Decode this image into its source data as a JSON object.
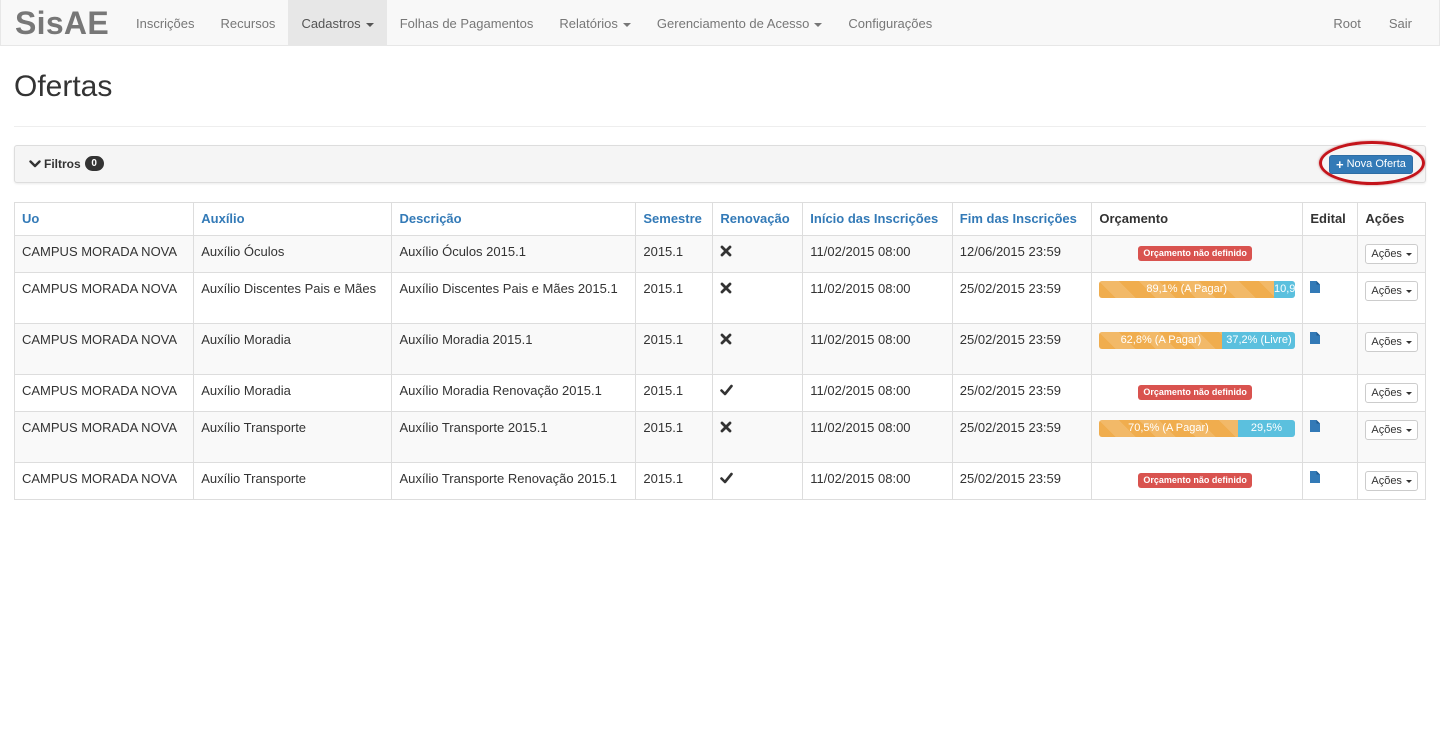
{
  "navbar": {
    "brand": "SisAE",
    "items": [
      {
        "label": "Inscrições",
        "dropdown": false,
        "active": false
      },
      {
        "label": "Recursos",
        "dropdown": false,
        "active": false
      },
      {
        "label": "Cadastros",
        "dropdown": true,
        "active": true
      },
      {
        "label": "Folhas de Pagamentos",
        "dropdown": false,
        "active": false
      },
      {
        "label": "Relatórios",
        "dropdown": true,
        "active": false
      },
      {
        "label": "Gerenciamento de Acesso",
        "dropdown": true,
        "active": false
      },
      {
        "label": "Configurações",
        "dropdown": false,
        "active": false
      }
    ],
    "right": [
      {
        "label": "Root"
      },
      {
        "label": "Sair"
      }
    ]
  },
  "page": {
    "title": "Ofertas"
  },
  "filters": {
    "label": "Filtros",
    "count": "0"
  },
  "new_offer_button": {
    "label": "Nova Oferta"
  },
  "table": {
    "headers": {
      "uo": "Uo",
      "auxilio": "Auxílio",
      "descricao": "Descrição",
      "semestre": "Semestre",
      "renovacao": "Renovação",
      "inicio": "Início das Inscrições",
      "fim": "Fim das Inscrições",
      "orcamento": "Orçamento",
      "edital": "Edital",
      "acoes": "Ações"
    },
    "action_label": "Ações",
    "rows": [
      {
        "uo": "CAMPUS MORADA NOVA",
        "auxilio": "Auxílio Óculos",
        "descricao": "Auxílio Óculos 2015.1",
        "semestre": "2015.1",
        "renovacao": false,
        "inicio": "11/02/2015 08:00",
        "fim": "12/06/2015 23:59",
        "budget": {
          "defined": false,
          "label": "Orçamento não definido"
        },
        "edital": false
      },
      {
        "uo": "CAMPUS MORADA NOVA",
        "auxilio": "Auxílio Discentes Pais e Mães",
        "descricao": "Auxílio Discentes Pais e Mães 2015.1",
        "semestre": "2015.1",
        "renovacao": false,
        "inicio": "11/02/2015 08:00",
        "fim": "25/02/2015 23:59",
        "budget": {
          "defined": true,
          "pagar_pct": 89.1,
          "pagar_label": "89,1% (A Pagar)",
          "livre_pct": 10.9,
          "livre_label": "10,9"
        },
        "edital": true
      },
      {
        "uo": "CAMPUS MORADA NOVA",
        "auxilio": "Auxílio Moradia",
        "descricao": "Auxílio Moradia 2015.1",
        "semestre": "2015.1",
        "renovacao": false,
        "inicio": "11/02/2015 08:00",
        "fim": "25/02/2015 23:59",
        "budget": {
          "defined": true,
          "pagar_pct": 62.8,
          "pagar_label": "62,8% (A Pagar)",
          "livre_pct": 37.2,
          "livre_label": "37,2% (Livre)"
        },
        "edital": true
      },
      {
        "uo": "CAMPUS MORADA NOVA",
        "auxilio": "Auxílio Moradia",
        "descricao": "Auxílio Moradia Renovação 2015.1",
        "semestre": "2015.1",
        "renovacao": true,
        "inicio": "11/02/2015 08:00",
        "fim": "25/02/2015 23:59",
        "budget": {
          "defined": false,
          "label": "Orçamento não definido"
        },
        "edital": false
      },
      {
        "uo": "CAMPUS MORADA NOVA",
        "auxilio": "Auxílio Transporte",
        "descricao": "Auxílio Transporte 2015.1",
        "semestre": "2015.1",
        "renovacao": false,
        "inicio": "11/02/2015 08:00",
        "fim": "25/02/2015 23:59",
        "budget": {
          "defined": true,
          "pagar_pct": 70.5,
          "pagar_label": "70,5% (A Pagar)",
          "livre_pct": 29.5,
          "livre_label": "29,5%"
        },
        "edital": true
      },
      {
        "uo": "CAMPUS MORADA NOVA",
        "auxilio": "Auxílio Transporte",
        "descricao": "Auxílio Transporte Renovação 2015.1",
        "semestre": "2015.1",
        "renovacao": true,
        "inicio": "11/02/2015 08:00",
        "fim": "25/02/2015 23:59",
        "budget": {
          "defined": false,
          "label": "Orçamento não definido"
        },
        "edital": true
      }
    ]
  },
  "icons": {
    "check": "check-icon",
    "cross": "times-icon",
    "file": "file-icon",
    "chevron": "chevron-down-icon",
    "plus": "plus-icon"
  },
  "colors": {
    "primary": "#337ab7",
    "warning": "#f0ad4e",
    "info": "#5bc0de",
    "danger": "#d9534f",
    "highlight": "#c4141b"
  }
}
